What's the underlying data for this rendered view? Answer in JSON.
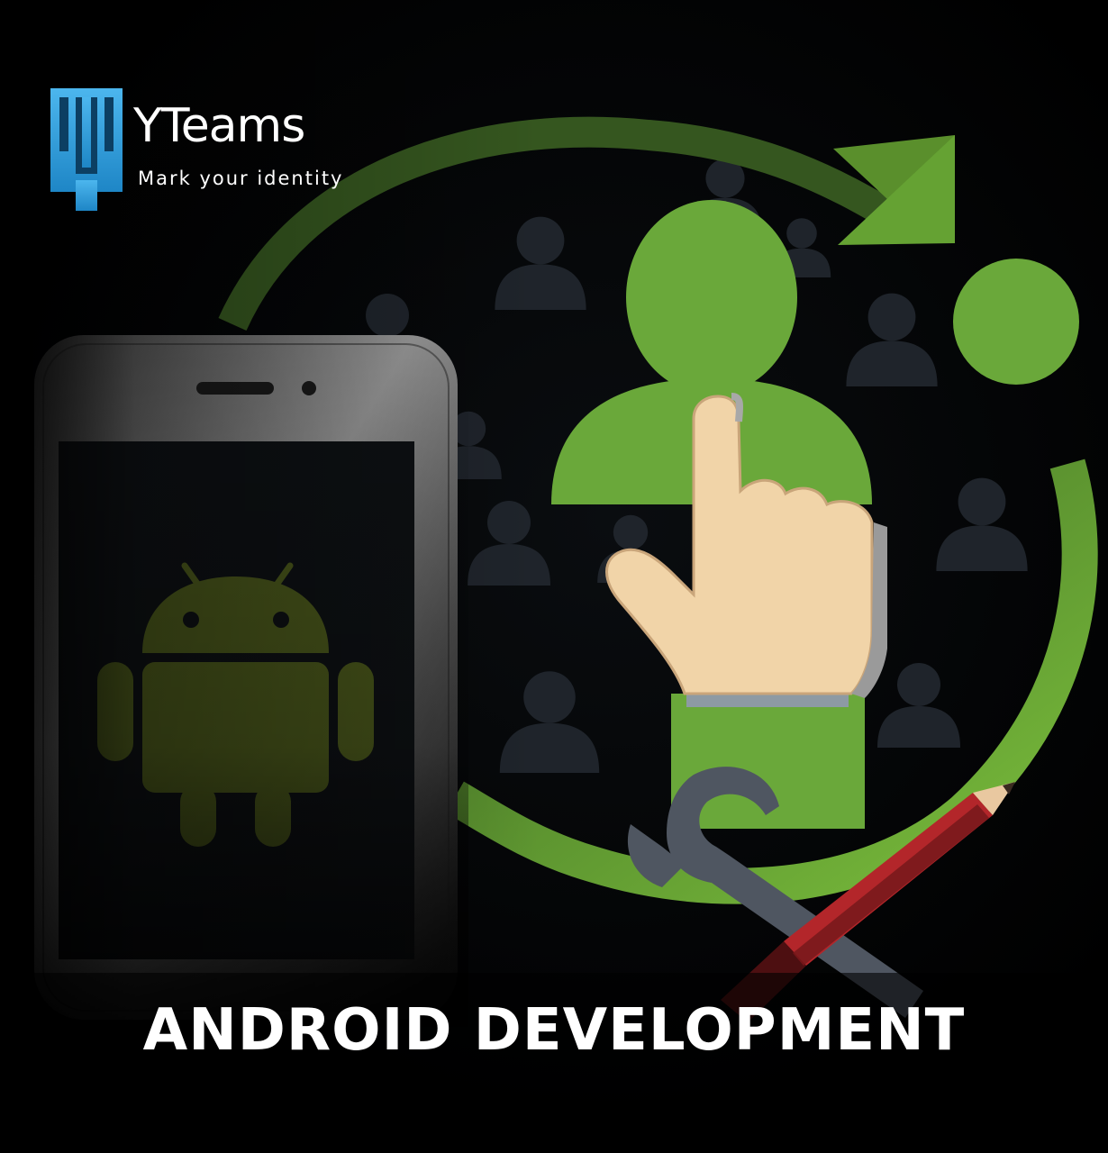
{
  "brand": {
    "name": "YTeams",
    "tagline": "Mark your identity",
    "logo_color": "#2f9ad8"
  },
  "title": "ANDROID DEVELOPMENT",
  "colors": {
    "background": "#000000",
    "accent_green": "#6aa83a",
    "crowd_silhouette": "#1f242b",
    "skin": "#f1d4a8",
    "pencil_red": "#b3262a",
    "wrench_gray": "#4f5661"
  },
  "icons": [
    "phone-icon",
    "android-robot-icon",
    "refresh-arrow-icon",
    "pointing-hand-icon",
    "crowd-icon",
    "wrench-icon",
    "pencil-icon"
  ]
}
